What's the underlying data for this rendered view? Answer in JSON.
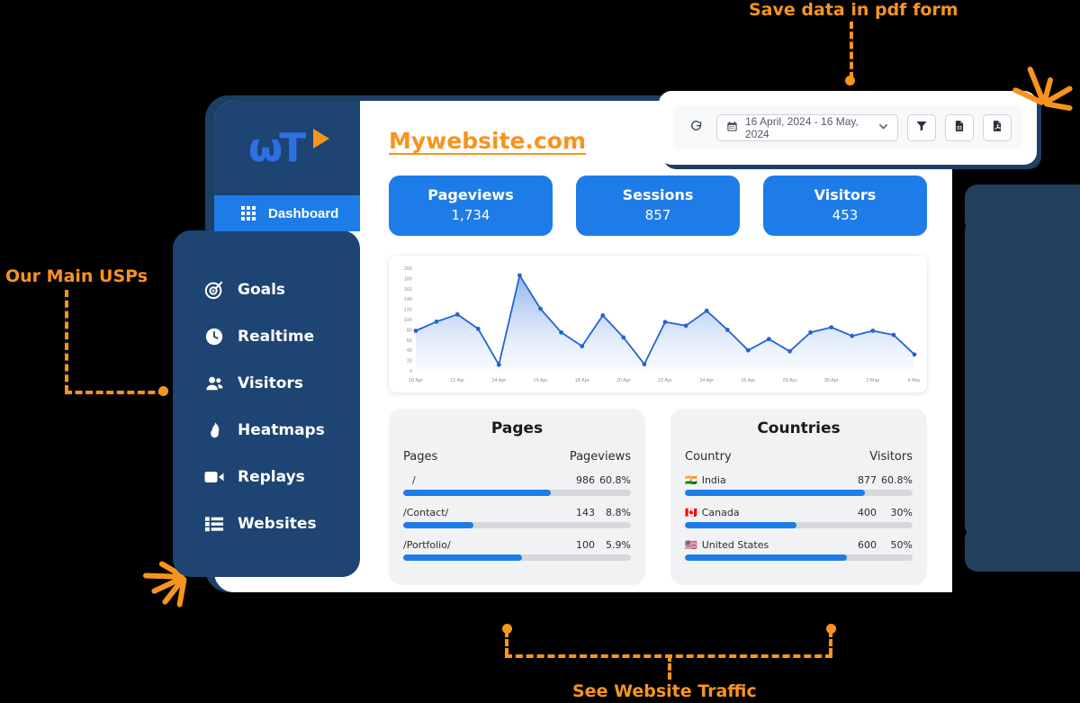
{
  "annotations": {
    "top": "Save data in pdf form",
    "left": "Our Main USPs",
    "bottom": "See Website Traffic"
  },
  "sidebar": {
    "logo_text": "ωT",
    "active_item": {
      "label": "Dashboard",
      "icon": "grid-icon"
    },
    "items": [
      {
        "label": "Goals",
        "icon": "target-icon"
      },
      {
        "label": "Realtime",
        "icon": "clock-icon"
      },
      {
        "label": "Visitors",
        "icon": "users-icon"
      },
      {
        "label": "Heatmaps",
        "icon": "flame-icon"
      },
      {
        "label": "Replays",
        "icon": "video-camera-icon"
      },
      {
        "label": "Websites",
        "icon": "list-icon"
      }
    ]
  },
  "header": {
    "site_title": "Mywebsite.com"
  },
  "toolbar": {
    "refresh_icon": "refresh-icon",
    "calendar_icon": "calendar-icon",
    "date_range": "16 April, 2024 - 16 May, 2024",
    "dropdown_icon": "chevron-down-icon",
    "filter_icon": "filter-icon",
    "export_excel_icon": "export-excel-icon",
    "export_pdf_icon": "export-pdf-icon"
  },
  "stats": [
    {
      "label": "Pageviews",
      "value": "1,734"
    },
    {
      "label": "Sessions",
      "value": "857"
    },
    {
      "label": "Visitors",
      "value": "453"
    }
  ],
  "chart_data": {
    "type": "area",
    "title": "",
    "xlabel": "",
    "ylabel": "",
    "ylim": [
      0,
      200
    ],
    "ytick_step": 20,
    "yticks": [
      0,
      20,
      40,
      60,
      80,
      100,
      120,
      140,
      160,
      180,
      200
    ],
    "grid": false,
    "legend": "none",
    "line_color": "#2563d4",
    "fill_color": "#9fc0ef",
    "x": [
      "10 Apr",
      "11 Apr",
      "12 Apr",
      "13 Apr",
      "14 Apr",
      "15 Apr",
      "16 Apr",
      "17 Apr",
      "18 Apr",
      "19 Apr",
      "20 Apr",
      "21 Apr",
      "22 Apr",
      "23 Apr",
      "24 Apr",
      "25 Apr",
      "26 Apr",
      "27 Apr",
      "28 Apr",
      "29 Apr",
      "30 Apr",
      "1 May",
      "2 May",
      "3 May",
      "4 May"
    ],
    "xtick_labels": [
      "10 Apr",
      "12 Apr",
      "14 Apr",
      "16 Apr",
      "18 Apr",
      "20 Apr",
      "22 Apr",
      "24 Apr",
      "26 Apr",
      "28 Apr",
      "30 Apr",
      "2 May",
      "4 May"
    ],
    "values": [
      78,
      96,
      110,
      82,
      12,
      186,
      121,
      75,
      48,
      108,
      65,
      13,
      95,
      88,
      117,
      80,
      40,
      62,
      38,
      75,
      85,
      68,
      78,
      70,
      32
    ]
  },
  "pages_panel": {
    "title": "Pages",
    "col_name": "Pages",
    "col_value": "Pageviews",
    "rows": [
      {
        "name": "/",
        "value": "986",
        "percent": "60.8%",
        "bar": 65
      },
      {
        "name": "/Contact/",
        "value": "143",
        "percent": "8.8%",
        "bar": 31
      },
      {
        "name": "/Portfolio/",
        "value": "100",
        "percent": "5.9%",
        "bar": 52
      }
    ]
  },
  "countries_panel": {
    "title": "Countries",
    "col_name": "Country",
    "col_value": "Visitors",
    "rows": [
      {
        "flag": "🇮🇳",
        "name": "India",
        "value": "877",
        "percent": "60.8%",
        "bar": 79
      },
      {
        "flag": "🇨🇦",
        "name": "Canada",
        "value": "400",
        "percent": "30%",
        "bar": 49
      },
      {
        "flag": "🇺🇸",
        "name": "United States",
        "value": "600",
        "percent": "50%",
        "bar": 71
      }
    ]
  },
  "colors": {
    "accent_orange": "#f7941e",
    "brand_blue": "#1e7ce8",
    "sidebar_navy": "#1d4472",
    "panel_gray": "#f1f2f4"
  }
}
